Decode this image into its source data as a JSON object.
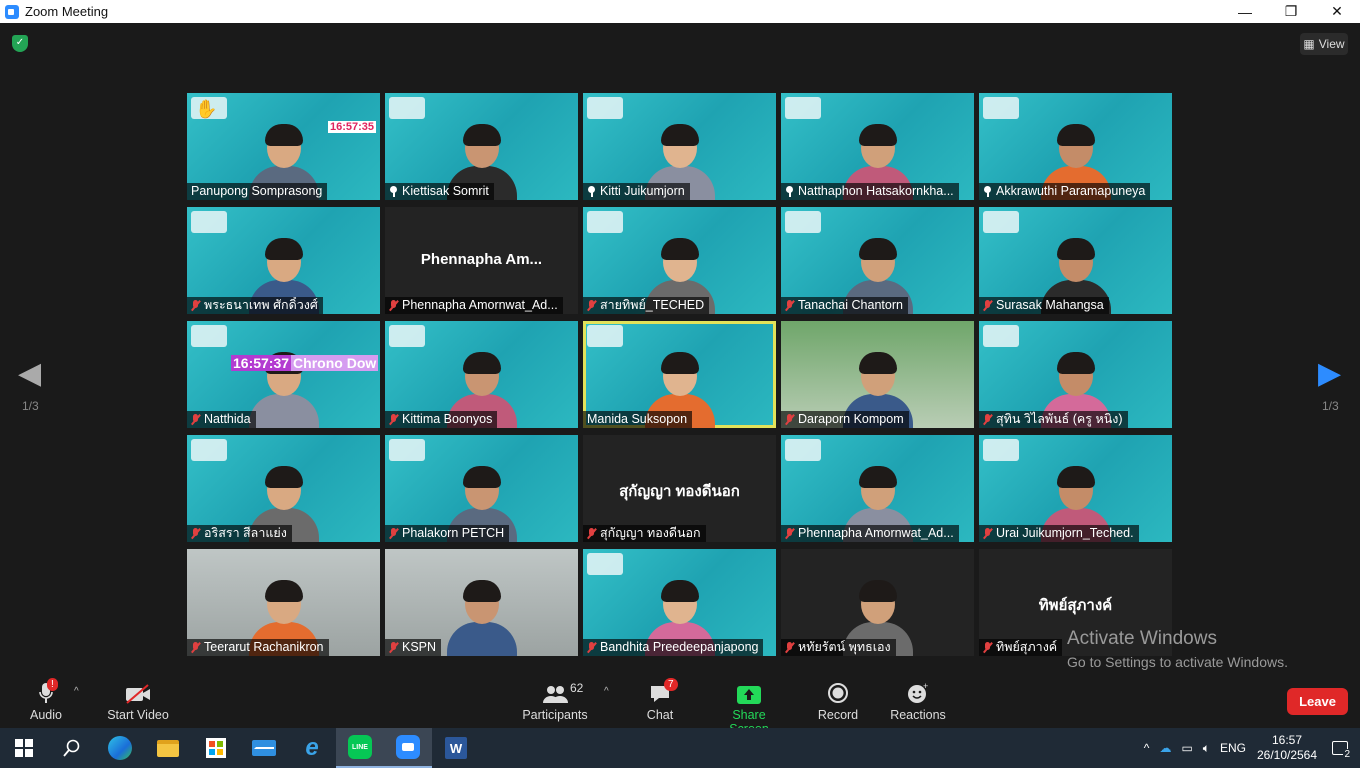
{
  "window": {
    "title": "Zoom Meeting",
    "minimize": "—",
    "maximize": "❐",
    "close": "✕"
  },
  "view_button": {
    "label": "View"
  },
  "nav": {
    "left_label": "1/3",
    "right_label": "1/3"
  },
  "tiles": [
    {
      "name": "Panupong Somprasong",
      "status": "hand",
      "bg": "teal",
      "clock": "16:57:35"
    },
    {
      "name": "Kiettisak Somrit",
      "status": "pin",
      "bg": "teal"
    },
    {
      "name": "Kitti Juikumjorn",
      "status": "pin",
      "bg": "teal"
    },
    {
      "name": "Natthaphon Hatsakornkha...",
      "status": "pin",
      "bg": "teal"
    },
    {
      "name": "Akkrawuthi Paramapuneya",
      "status": "pin",
      "bg": "teal"
    },
    {
      "name": "พระธนาเทพ ศักดิ์วงศ์",
      "status": "muted",
      "bg": "teal"
    },
    {
      "name": "Phennapha Amornwat_Ad...",
      "status": "muted",
      "bg": "dark",
      "display": "Phennapha  Am..."
    },
    {
      "name": "สายทิพย์_TECHED",
      "status": "muted",
      "bg": "teal"
    },
    {
      "name": "Tanachai Chantorn",
      "status": "muted",
      "bg": "teal"
    },
    {
      "name": "Surasak Mahangsa",
      "status": "muted",
      "bg": "teal"
    },
    {
      "name": "Natthida",
      "status": "muted",
      "bg": "teal",
      "chrono_time": "16:57:37",
      "chrono_text": "Chrono Dow"
    },
    {
      "name": "Kittima Boonyos",
      "status": "muted",
      "bg": "teal"
    },
    {
      "name": "Manida Suksopon",
      "status": "none",
      "bg": "teal",
      "active": true
    },
    {
      "name": "Daraporn Kompom",
      "status": "muted",
      "bg": "green"
    },
    {
      "name": "สุทิน วิไลพันธ์ (ครู หนิง)",
      "status": "muted",
      "bg": "teal"
    },
    {
      "name": "อริสรา สีลาแย่ง",
      "status": "muted",
      "bg": "teal"
    },
    {
      "name": "Phalakorn PETCH",
      "status": "muted",
      "bg": "teal"
    },
    {
      "name": "สุกัญญา ทองดีนอก",
      "status": "muted",
      "bg": "dark",
      "display": "สุกัญญา ทองดีนอก"
    },
    {
      "name": "Phennapha Amornwat_Ad...",
      "status": "muted",
      "bg": "teal"
    },
    {
      "name": "Urai Juikumjorn_Teched.",
      "status": "muted",
      "bg": "teal"
    },
    {
      "name": "Teerarut Rachanikron",
      "status": "muted",
      "bg": "room"
    },
    {
      "name": "KSPN",
      "status": "muted",
      "bg": "room"
    },
    {
      "name": "Bandhita Preedeepanjapong",
      "status": "muted",
      "bg": "teal"
    },
    {
      "name": "หทัยรัตน์ พุทธเอง",
      "status": "muted",
      "bg": "dark"
    },
    {
      "name": "ทิพย์สุภางค์",
      "status": "muted",
      "bg": "dark",
      "display": "ทิพย์สุภางค์"
    }
  ],
  "activation": {
    "line1": "Activate Windows",
    "line2": "Go to Settings to activate Windows."
  },
  "toolbar": {
    "audio": "Audio",
    "start_video": "Start Video",
    "participants": "Participants",
    "participants_count": "62",
    "chat": "Chat",
    "chat_badge": "7",
    "share_screen": "Share Screen",
    "record": "Record",
    "reactions": "Reactions",
    "leave": "Leave",
    "audio_badge": "!"
  },
  "taskbar": {
    "lang": "ENG",
    "time": "16:57",
    "date": "26/10/2564",
    "notif_count": "2"
  },
  "colors": {
    "accent": "#2d8cff",
    "leave": "#e02828",
    "share": "#23d959",
    "active_border": "#e2e25a"
  }
}
